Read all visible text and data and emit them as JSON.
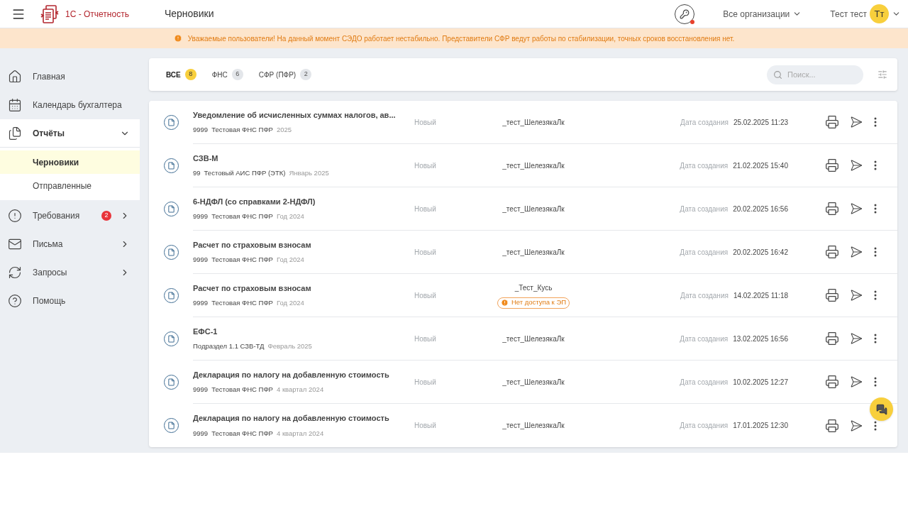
{
  "header": {
    "brand": "1С - Отчетность",
    "page_title": "Черновики",
    "org_selector": "Все организации",
    "user_name": "Тест тест",
    "avatar": "Тт"
  },
  "banner": {
    "text": "Уважаемые пользователи! На данный момент СЭДО работает нестабильно. Представители СФР ведут работы по стабилизации, точных сроков восстановления нет."
  },
  "sidebar": {
    "items": [
      {
        "kind": "link",
        "label": "Главная"
      },
      {
        "kind": "link",
        "label": "Календарь бухгалтера"
      },
      {
        "kind": "group",
        "label": "Отчёты",
        "expanded": true,
        "children": [
          {
            "label": "Черновики",
            "selected": true
          },
          {
            "label": "Отправленные",
            "selected": false
          }
        ]
      },
      {
        "kind": "group",
        "label": "Требования",
        "expanded": false,
        "badge": "2"
      },
      {
        "kind": "group",
        "label": "Письма",
        "expanded": false
      },
      {
        "kind": "group",
        "label": "Запросы",
        "expanded": false
      },
      {
        "kind": "link",
        "label": "Помощь"
      }
    ]
  },
  "filters": {
    "tabs": [
      {
        "label": "ВСЕ",
        "count": "8",
        "selected": true
      },
      {
        "label": "ФНС",
        "count": "6",
        "selected": false
      },
      {
        "label": "СФР (ПФР)",
        "count": "2",
        "selected": false
      }
    ],
    "search": {
      "placeholder": "Поиск..."
    }
  },
  "rows": [
    {
      "title": "Уведомление об исчисленных суммах налогов, ав...",
      "parts": [
        "9999",
        "Тестовая ФНС ПФР"
      ],
      "period": "2025",
      "status": "Новый",
      "owner": "_тест_ШелезякаЛк",
      "date_label": "Дата создания",
      "date": "25.02.2025 11:23"
    },
    {
      "title": "СЗВ-М",
      "parts": [
        "99",
        "Тестовый АИС ПФР (ЭТК)"
      ],
      "period": "Январь 2025",
      "status": "Новый",
      "owner": "_тест_ШелезякаЛк",
      "date_label": "Дата создания",
      "date": "21.02.2025 15:40"
    },
    {
      "title": "6-НДФЛ (со справками 2-НДФЛ)",
      "parts": [
        "9999",
        "Тестовая ФНС ПФР"
      ],
      "period": "Год 2024",
      "status": "Новый",
      "owner": "_тест_ШелезякаЛк",
      "date_label": "Дата создания",
      "date": "20.02.2025 16:56"
    },
    {
      "title": "Расчет по страховым взносам",
      "parts": [
        "9999",
        "Тестовая ФНС ПФР"
      ],
      "period": "Год 2024",
      "status": "Новый",
      "owner": "_тест_ШелезякаЛк",
      "date_label": "Дата создания",
      "date": "20.02.2025 16:42"
    },
    {
      "title": "Расчет по страховым взносам",
      "parts": [
        "9999",
        "Тестовая ФНС ПФР"
      ],
      "period": "Год 2024",
      "status": "Новый",
      "owner": "_Тест_Кусь",
      "warning": "Нет доступа к ЭП",
      "date_label": "Дата создания",
      "date": "14.02.2025 11:18"
    },
    {
      "title": "ЕФС-1",
      "parts": [
        "Подраздел 1.1 СЗВ-ТД"
      ],
      "period": "Февраль 2025",
      "status": "Новый",
      "owner": "_тест_ШелезякаЛк",
      "date_label": "Дата создания",
      "date": "13.02.2025 16:56"
    },
    {
      "title": "Декларация по налогу на добавленную стоимость",
      "parts": [
        "9999",
        "Тестовая ФНС ПФР"
      ],
      "period": "4 квартал 2024",
      "status": "Новый",
      "owner": "_тест_ШелезякаЛк",
      "date_label": "Дата создания",
      "date": "10.02.2025 12:27"
    },
    {
      "title": "Декларация по налогу на добавленную стоимость",
      "parts": [
        "9999",
        "Тестовая ФНС ПФР"
      ],
      "period": "4 квартал 2024",
      "status": "Новый",
      "owner": "_тест_ШелезякаЛк",
      "date_label": "Дата создания",
      "date": "17.01.2025 12:30"
    }
  ]
}
